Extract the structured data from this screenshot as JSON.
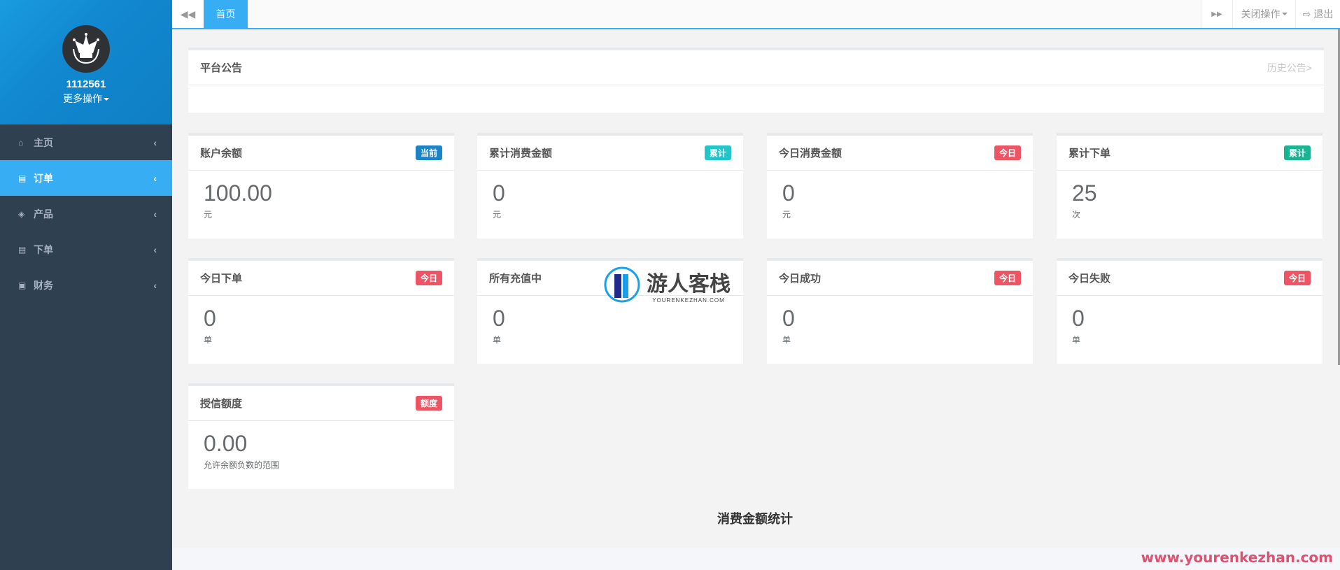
{
  "sidebar": {
    "username": "1112561",
    "more_label": "更多操作",
    "items": [
      {
        "label": "主页",
        "icon": "home-icon"
      },
      {
        "label": "订单",
        "icon": "file-icon",
        "active": true
      },
      {
        "label": "产品",
        "icon": "cube-icon"
      },
      {
        "label": "下单",
        "icon": "file-icon"
      },
      {
        "label": "财务",
        "icon": "money-icon"
      }
    ]
  },
  "topbar": {
    "home_tab": "首页",
    "close_ops": "关闭操作",
    "logout": "退出"
  },
  "notice": {
    "title": "平台公告",
    "history": "历史公告>"
  },
  "cards": [
    {
      "title": "账户余额",
      "badge": "当前",
      "badge_color": "#1c84c6",
      "value": "100.00",
      "unit": "元"
    },
    {
      "title": "累计消费金额",
      "badge": "累计",
      "badge_color": "#23c6c8",
      "value": "0",
      "unit": "元"
    },
    {
      "title": "今日消费金额",
      "badge": "今日",
      "badge_color": "#ed5565",
      "value": "0",
      "unit": "元"
    },
    {
      "title": "累计下单",
      "badge": "累计",
      "badge_color": "#1ab394",
      "value": "25",
      "unit": "次"
    },
    {
      "title": "今日下单",
      "badge": "今日",
      "badge_color": "#ed5565",
      "value": "0",
      "unit": "单"
    },
    {
      "title": "所有充值中",
      "badge": "",
      "badge_color": "#1ab394",
      "value": "0",
      "unit": "单"
    },
    {
      "title": "今日成功",
      "badge": "今日",
      "badge_color": "#ed5565",
      "value": "0",
      "unit": "单"
    },
    {
      "title": "今日失败",
      "badge": "今日",
      "badge_color": "#ed5565",
      "value": "0",
      "unit": "单"
    },
    {
      "title": "授信额度",
      "badge": "额度",
      "badge_color": "#ed5565",
      "value": "0.00",
      "unit": "允许余额负数的范围"
    }
  ],
  "stats_title": "消费金额统计",
  "watermark": {
    "logo_text": "游人客栈",
    "logo_sub": "YOURENKEZHAN.COM",
    "url": "www.yourenkezhan.com"
  }
}
